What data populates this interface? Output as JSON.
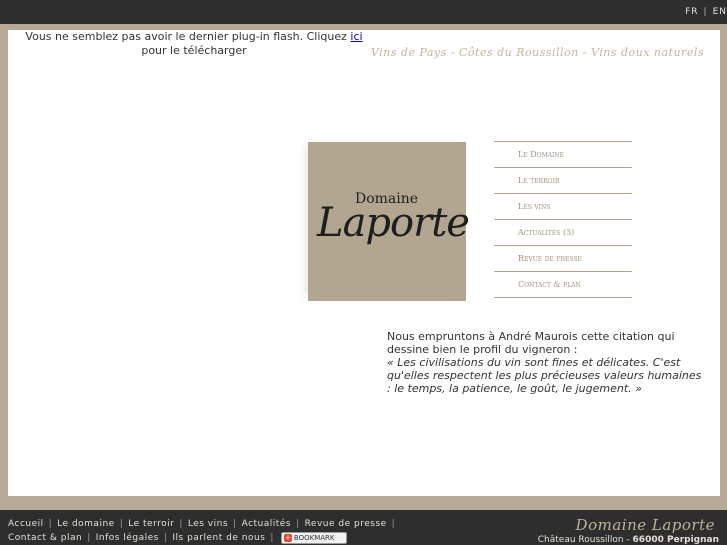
{
  "lang": {
    "fr": "FR",
    "sep": "|",
    "en": "EN"
  },
  "flash": {
    "before": "Vous ne semblez pas avoir le dernier plug-in flash. Cliquez ",
    "link": "ici",
    "after": " pour le télécharger"
  },
  "tagline": "Vins de Pays - Côtes du Roussillon - Vins doux naturels",
  "logo": {
    "top": "Domaine",
    "main": "Laporte"
  },
  "nav": [
    {
      "label": "Le Domaine"
    },
    {
      "label": "Le terroir"
    },
    {
      "label": "Les vins"
    },
    {
      "label": "Actualités (3)"
    },
    {
      "label": "Revue de presse"
    },
    {
      "label": "Contact & plan"
    }
  ],
  "quote": {
    "intro": "Nous empruntons à André Maurois cette citation qui dessine bien le profil du vigneron :",
    "text": "« Les civilisations du vin sont fines et délicates. C'est qu'elles respectent les plus précieuses valeurs humaines : le temps, la patience, le goût, le jugement. »"
  },
  "footer": {
    "links": [
      "Accueil",
      "Le domaine",
      "Le terroir",
      "Les vins",
      "Actualités",
      "Revue de presse",
      "Contact & plan",
      "Infos légales",
      "Ils parlent de nous"
    ],
    "bookmark": "BOOKMARK",
    "brand": "Domaine Laporte",
    "address_plain": "Château Roussillon - ",
    "address_bold": "66000 Perpignan"
  },
  "colors": {
    "accent": "#b3a690",
    "dark": "#2e2e2e",
    "tagline": "#c2b59b"
  }
}
